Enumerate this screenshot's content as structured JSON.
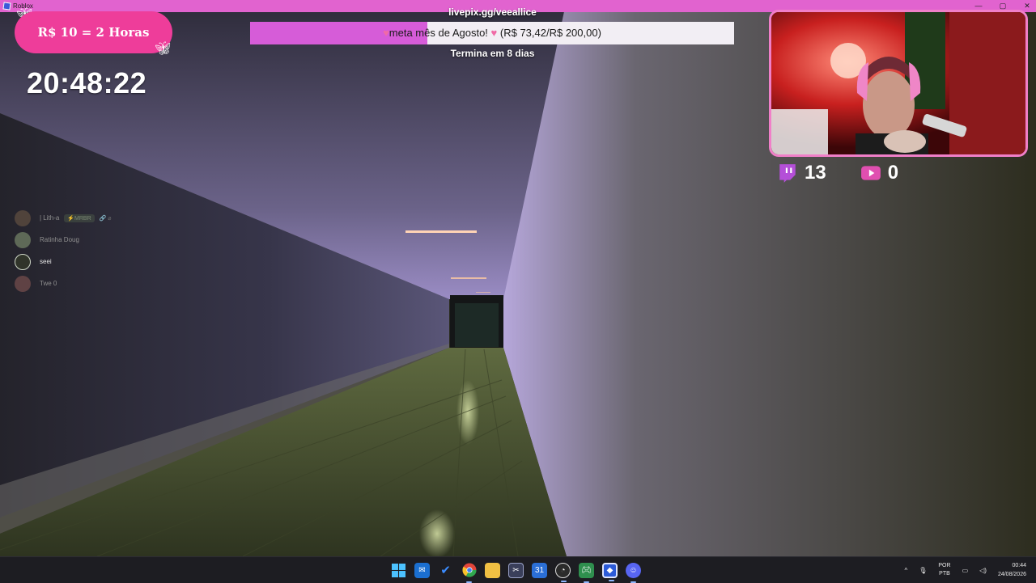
{
  "window": {
    "app_title": "Roblox",
    "controls": [
      "—",
      "▢",
      "✕"
    ]
  },
  "promo": {
    "text": "R$ 10 = 2 Horas"
  },
  "timer": {
    "value": "20:48:22"
  },
  "goal": {
    "url": "livepix.gg/veeallice",
    "label": "meta mês de Agosto!",
    "amount": "(R$ 73,42/R$ 200,00)",
    "progress_fraction": 0.367,
    "ends": "Termina em 8 dias",
    "fill_color": "#d65cd8"
  },
  "viewers": {
    "twitch_count": "13",
    "youtube_count": "0",
    "twitch_icon": "twitch-icon",
    "youtube_icon": "youtube-icon"
  },
  "players": [
    {
      "name": "| Lith-a",
      "badge": "⚡MRBR",
      "extra": "🔗 ⌀",
      "bright": false
    },
    {
      "name": "Ratinha Doug",
      "bright": false
    },
    {
      "name": "seei",
      "bright": true
    },
    {
      "name": "Twe 0",
      "bright": false
    }
  ],
  "taskbar": {
    "apps": [
      "windows-start-icon",
      "mail-icon",
      "todo-icon",
      "chrome-icon",
      "file-explorer-icon",
      "snipping-icon",
      "calendar-icon",
      "obs-icon",
      "gamepad-icon",
      "roblox-icon",
      "discord-icon"
    ],
    "lang_top": "POR",
    "lang_bottom": "PTB",
    "time": "00:44",
    "date": "24/08/2026",
    "tray_chevron": "^",
    "tray_mic": "🎙"
  },
  "colors": {
    "accent_pink": "#e163cf",
    "pill_pink": "#ee3d9a",
    "twitch_purple": "#9146ff",
    "youtube_pink": "#e04fb0"
  }
}
